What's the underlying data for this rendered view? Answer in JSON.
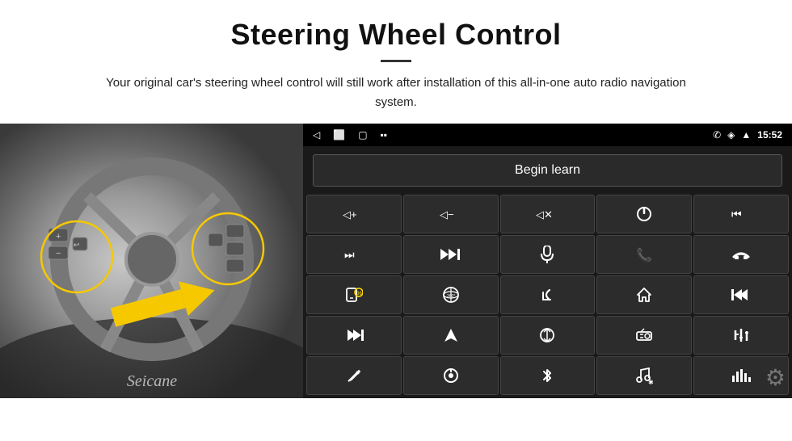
{
  "header": {
    "title": "Steering Wheel Control",
    "subtitle": "Your original car's steering wheel control will still work after installation of this all-in-one auto radio navigation system."
  },
  "status_bar": {
    "back_icon": "◁",
    "home_icon": "⬜",
    "recent_icon": "▢",
    "media_icon": "▪▪",
    "phone_icon": "✆",
    "wifi_icon": "◈",
    "signal_icon": "▲",
    "time": "15:52"
  },
  "begin_learn": {
    "label": "Begin learn"
  },
  "controls": [
    {
      "icon": "🔊+",
      "label": "vol-up"
    },
    {
      "icon": "🔊−",
      "label": "vol-down"
    },
    {
      "icon": "🔇",
      "label": "mute"
    },
    {
      "icon": "⏻",
      "label": "power"
    },
    {
      "icon": "⏮",
      "label": "prev-track"
    },
    {
      "icon": "⏭",
      "label": "next"
    },
    {
      "icon": "⏭⏭",
      "label": "fast-forward"
    },
    {
      "icon": "🎙",
      "label": "mic"
    },
    {
      "icon": "📞",
      "label": "call"
    },
    {
      "icon": "↩",
      "label": "hang-up"
    },
    {
      "icon": "📱",
      "label": "screen"
    },
    {
      "icon": "👁360",
      "label": "camera-360"
    },
    {
      "icon": "↩",
      "label": "back"
    },
    {
      "icon": "🏠",
      "label": "home"
    },
    {
      "icon": "⏮⏮",
      "label": "skip-back"
    },
    {
      "icon": "⏭⏭",
      "label": "skip-forward"
    },
    {
      "icon": "◀",
      "label": "nav"
    },
    {
      "icon": "⇄",
      "label": "swap"
    },
    {
      "icon": "📻",
      "label": "radio"
    },
    {
      "icon": "⫶",
      "label": "equalizer"
    },
    {
      "icon": "✏",
      "label": "edit"
    },
    {
      "icon": "⊙",
      "label": "knob"
    },
    {
      "icon": "✱",
      "label": "bluetooth"
    },
    {
      "icon": "♪✱",
      "label": "music"
    },
    {
      "icon": "📊",
      "label": "spectrum"
    }
  ],
  "watermark": "Seicane",
  "settings_icon": "⚙"
}
